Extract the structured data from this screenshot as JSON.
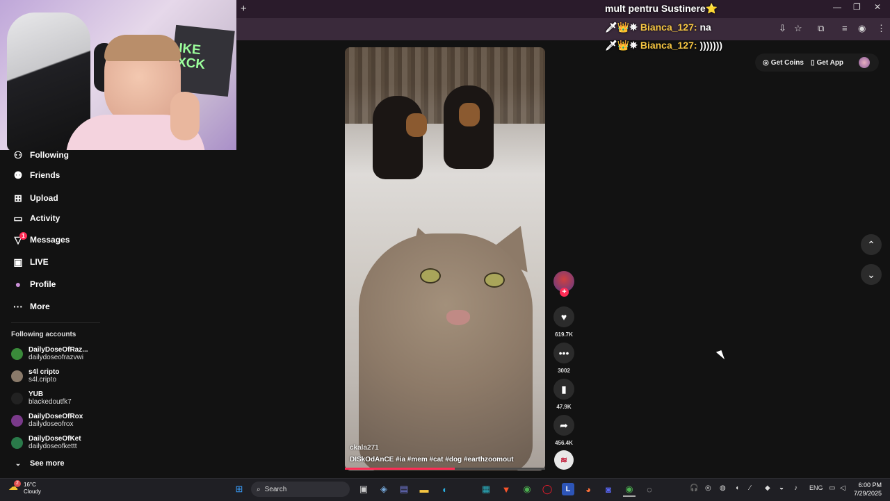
{
  "browser": {
    "new_tab_symbol": "+",
    "window_controls": [
      "—",
      "❐",
      "✕"
    ],
    "toolbar_icons": [
      "install-icon",
      "star-icon",
      "extensions-icon",
      "media-icon",
      "profile-icon",
      "menu-icon"
    ]
  },
  "stream_chat": [
    {
      "user": "",
      "text": "mult pentru Sustinere⭐"
    },
    {
      "user": "Bianca_127:",
      "text": "na"
    },
    {
      "user": "Bianca_127:",
      "text": ")))))))"
    }
  ],
  "stream_chat_badges": "🗡👑✵",
  "webcam": {
    "poster_text": "IKE\nXCK"
  },
  "sidebar": {
    "nav": [
      {
        "label": "Following",
        "icon": "following-icon",
        "glyph": "⚇"
      },
      {
        "label": "Friends",
        "icon": "friends-icon",
        "glyph": "⚉"
      },
      {
        "label": "Upload",
        "icon": "upload-icon",
        "glyph": "⊞"
      },
      {
        "label": "Activity",
        "icon": "activity-icon",
        "glyph": "▭"
      },
      {
        "label": "Messages",
        "icon": "messages-icon",
        "glyph": "▽"
      },
      {
        "label": "LIVE",
        "icon": "live-icon",
        "glyph": "▣"
      },
      {
        "label": "Profile",
        "icon": "profile-icon",
        "glyph": "●"
      },
      {
        "label": "More",
        "icon": "more-icon",
        "glyph": "···"
      }
    ],
    "messages_badge": "1",
    "following_title": "Following accounts",
    "accounts": [
      {
        "name": "DailyDoseOfRaz...",
        "handle": "dailydoseofrazvwi",
        "color": "#3a8a3a"
      },
      {
        "name": "s4l cripto",
        "handle": "s4l.cripto",
        "color": "#8a7a6a"
      },
      {
        "name": "YUB",
        "handle": "blackedoutfk7",
        "color": "#222222"
      },
      {
        "name": "DailyDoseOfRox",
        "handle": "dailydoseofrox",
        "color": "#7a3a8a"
      },
      {
        "name": "DailyDoseOfKet",
        "handle": "dailydoseofkettt",
        "color": "#2a7a4a"
      }
    ],
    "see_more": "See more"
  },
  "header": {
    "get_coins": "Get Coins",
    "get_app": "Get App"
  },
  "video": {
    "username": "ckala271",
    "caption": "DISkOdAnCE #ia #mem #cat #dog #earthzoomout",
    "progress": 0.55
  },
  "actions": {
    "likes": "619.7K",
    "comments": "3002",
    "saves": "47.9K",
    "shares": "456.4K"
  },
  "taskbar": {
    "weather_temp": "16°C",
    "weather_desc": "Cloudy",
    "weather_badge": "2",
    "search_label": "Search",
    "language": "ENG",
    "time": "6:00 PM",
    "date": "7/29/2025",
    "app_icons": [
      "windows-icon",
      "search-icon",
      "task-view-icon",
      "copilot-icon",
      "teams-icon",
      "file-explorer-icon",
      "edge-icon",
      "store-icon",
      "brave-icon",
      "chrome-icon",
      "opera-icon",
      "app-l-icon",
      "firefox-icon",
      "discord-icon",
      "chrome-active-icon",
      "obs-icon"
    ]
  }
}
